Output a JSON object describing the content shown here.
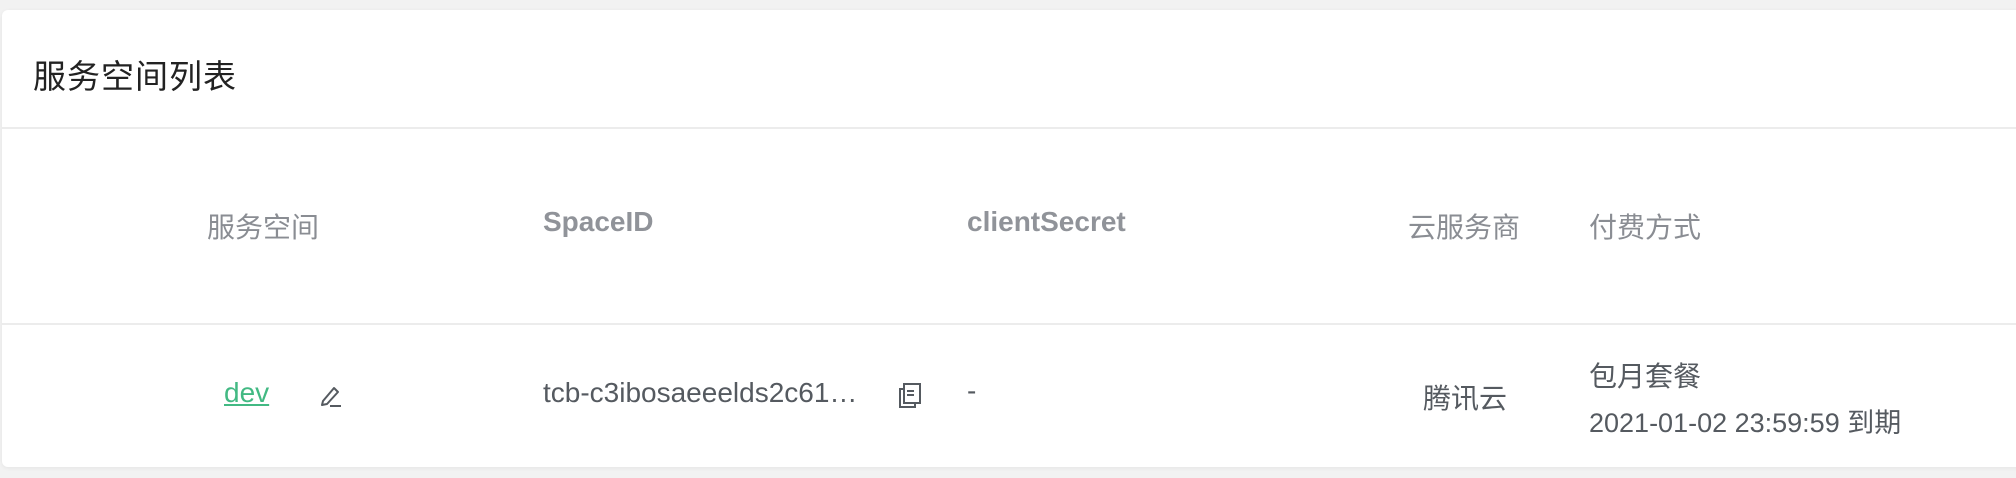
{
  "card": {
    "title": "服务空间列表"
  },
  "table": {
    "columns": {
      "space": "服务空间",
      "space_id": "SpaceID",
      "client_secret": "clientSecret",
      "provider": "云服务商",
      "payment": "付费方式"
    },
    "rows": [
      {
        "space_name": "dev",
        "space_id": "tcb-c3ibosaeeelds2c61…",
        "client_secret": "-",
        "provider": "腾讯云",
        "payment_type": "包月套餐",
        "payment_expire": "2021-01-02 23:59:59 到期"
      }
    ]
  },
  "colors": {
    "link": "#42b983",
    "header_text": "#909399",
    "body_text": "#555a60"
  },
  "icons": {
    "edit": "pencil-icon",
    "copy": "copy-icon"
  }
}
